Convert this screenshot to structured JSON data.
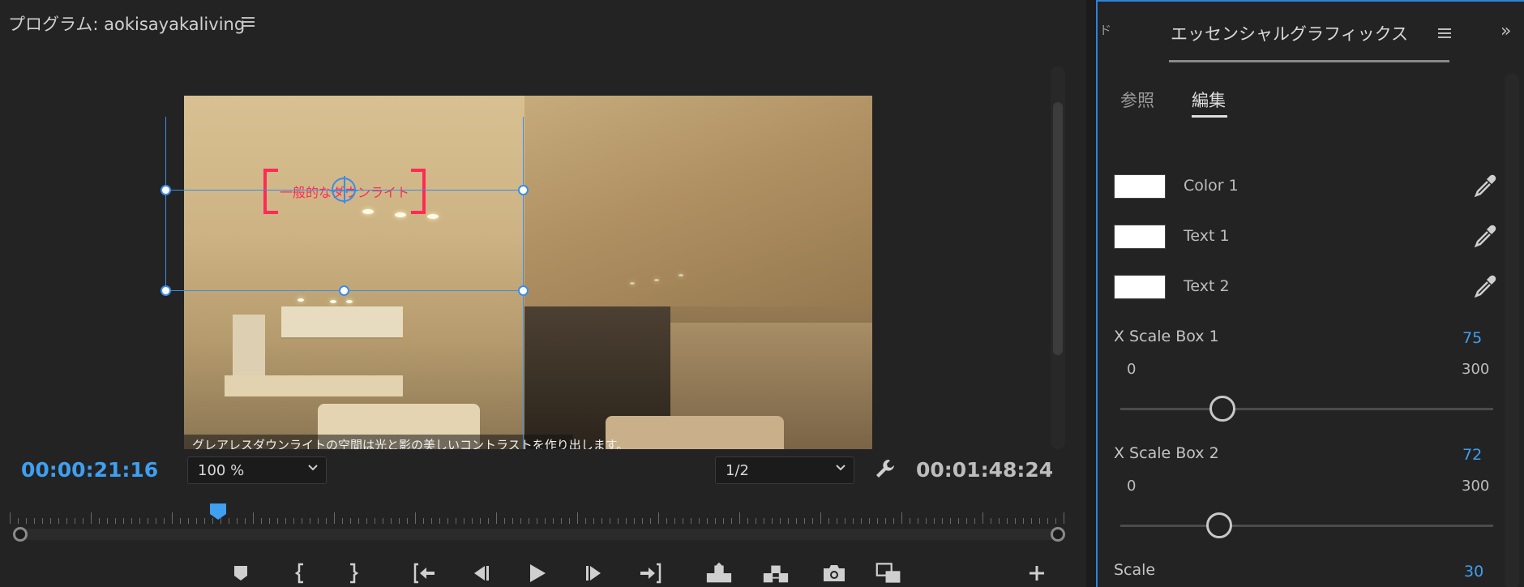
{
  "monitor": {
    "title": "プログラム: aokisayakaliving",
    "timecode_current": "00:00:21:16",
    "timecode_duration": "00:01:48:24",
    "zoom": "100 %",
    "resolution": "1/2",
    "overlay_text": "一般的なダウンライト",
    "caption": "グレアレスダウンライトの空間は光と影の美しいコントラストを作り出します。",
    "accent_color": "#3f9ff0",
    "overlay_color": "#ff2a55",
    "controls": [
      {
        "name": "add-marker-icon"
      },
      {
        "name": "mark-in-icon"
      },
      {
        "name": "mark-out-icon"
      },
      {
        "name": "go-to-in-icon"
      },
      {
        "name": "step-back-icon"
      },
      {
        "name": "play-icon"
      },
      {
        "name": "step-forward-icon"
      },
      {
        "name": "go-to-out-icon"
      },
      {
        "name": "lift-icon"
      },
      {
        "name": "extract-icon"
      },
      {
        "name": "export-frame-icon"
      },
      {
        "name": "comparison-view-icon"
      },
      {
        "name": "add-button-icon"
      }
    ]
  },
  "panel": {
    "title": "エッセンシャルグラフィックス",
    "collapse_label": "ド",
    "tabs": {
      "browse": "参照",
      "edit": "編集"
    },
    "color_props": [
      {
        "label": "Color 1",
        "swatch": "#ffffff"
      },
      {
        "label": "Text 1",
        "swatch": "#ffffff"
      },
      {
        "label": "Text 2",
        "swatch": "#ffffff"
      }
    ],
    "sliders": [
      {
        "label": "X Scale Box 1",
        "value": "75",
        "min": "0",
        "max": "300"
      },
      {
        "label": "X Scale Box 2",
        "value": "72",
        "min": "0",
        "max": "300"
      },
      {
        "label": "Scale",
        "value": "30"
      }
    ]
  }
}
